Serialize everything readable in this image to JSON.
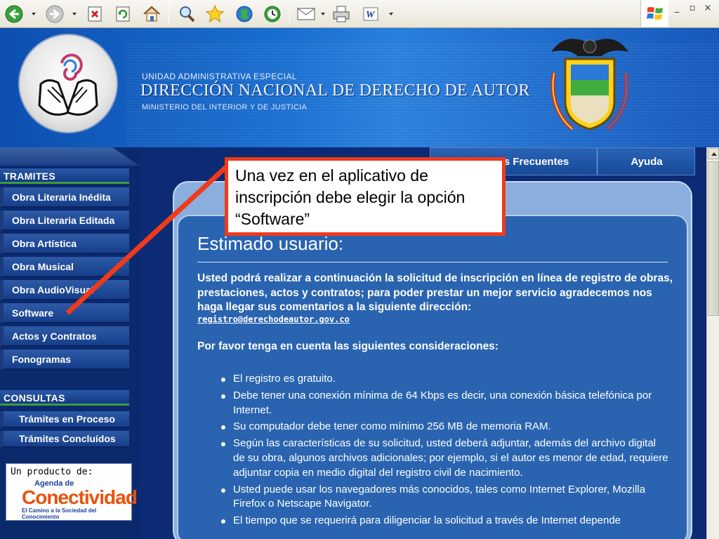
{
  "browser": {
    "toolbar_icons": [
      "back-icon",
      "forward-icon",
      "stop-icon",
      "refresh-icon",
      "home-icon",
      "search-icon",
      "favorites-icon",
      "media-icon",
      "history-icon",
      "mail-icon",
      "print-icon",
      "word-icon"
    ],
    "window_controls": [
      "_",
      "▫",
      "×"
    ]
  },
  "header": {
    "subtitle_top": "UNIDAD ADMINISTRATIVA ESPECIAL",
    "title": "DIRECCIÓN NACIONAL DE DERECHO DE AUTOR",
    "subtitle_bottom": "MINISTERIO DEL INTERIOR Y DE JUSTICIA"
  },
  "leftnav": {
    "tramites_heading": "TRAMITES",
    "tramites": [
      "Obra Literaria Inédita",
      "Obra Literaria Editada",
      "Obra Artística",
      "Obra Musical",
      "Obra AudioVisual",
      "Software",
      "Actos y Contratos",
      "Fonogramas"
    ],
    "consultas_heading": "CONSULTAS",
    "consultas": [
      "Trámites en Proceso",
      "Trámites Concluídos"
    ],
    "product": {
      "line1": "Un producto de:",
      "line2": "Agenda de",
      "line3": "Conectividad",
      "line4": "El Camino a la Sociedad del Conocimiento"
    }
  },
  "topnav": {
    "faq": "Preguntas Frecuentes",
    "help": "Ayuda"
  },
  "content": {
    "greeting": "Estimado usuario:",
    "intro": "Usted podrá realizar a continuación la solicitud de inscripción en línea de registro de obras, prestaciones, actos y contratos; para poder prestar un mejor servicio agradecemos nos haga llegar sus comentarios a la siguiente dirección:",
    "email": "registro@derechodeautor.gov.co",
    "considerations_heading": "Por favor tenga en cuenta las siguientes consideraciones:",
    "bullets": [
      "El registro es gratuito.",
      "Debe tener una conexión mínima de 64 Kbps es decir, una conexión básica telefónica por Internet.",
      "Su computador debe tener como mínimo 256 MB de memoria RAM.",
      "Según las características de su solicitud, usted deberá adjuntar, además del archivo digital de su obra, algunos archivos adicionales; por ejemplo, si el autor es menor de edad, requiere adjuntar copia en medio digital del registro civil de nacimiento.",
      "Usted puede usar los navegadores más conocidos, tales como Internet Explorer, Mozilla Firefox o Netscape Navigator.",
      "El tiempo que se requerirá para diligenciar la solicitud a través de Internet depende"
    ]
  },
  "annotation": {
    "text": "Una vez en el aplicativo de inscripción  debe elegir la opción “Software”"
  },
  "colors": {
    "callout_border": "#f03a1a",
    "nav_accent": "#3f9b3a",
    "page_bg": "#0a2a78"
  }
}
